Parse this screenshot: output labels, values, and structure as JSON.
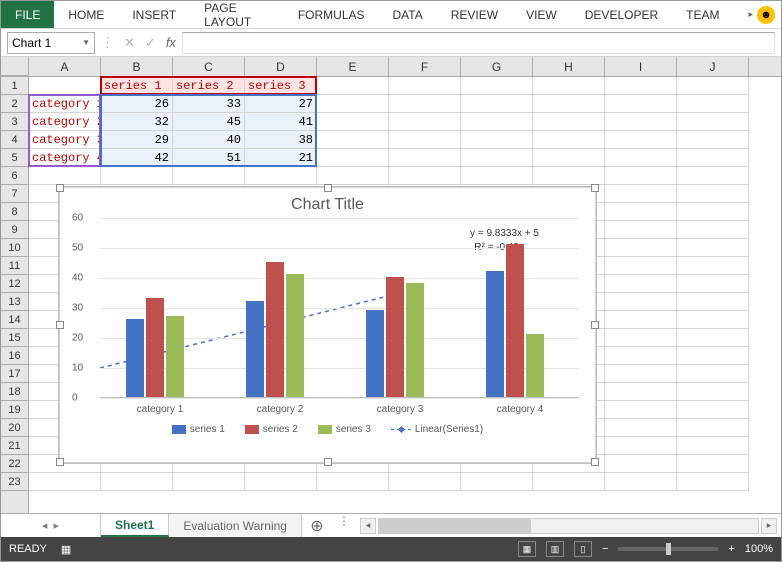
{
  "ribbon": {
    "tabs": [
      "FILE",
      "HOME",
      "INSERT",
      "PAGE LAYOUT",
      "FORMULAS",
      "DATA",
      "REVIEW",
      "VIEW",
      "DEVELOPER",
      "TEAM"
    ]
  },
  "namebox": "Chart 1",
  "fx_label": "fx",
  "columns": [
    "A",
    "B",
    "C",
    "D",
    "E",
    "F",
    "G",
    "H",
    "I",
    "J"
  ],
  "rows": [
    "1",
    "2",
    "3",
    "4",
    "5",
    "6",
    "7",
    "8",
    "9",
    "10",
    "11",
    "12",
    "13",
    "14",
    "15",
    "16",
    "17",
    "18",
    "19",
    "20",
    "21",
    "22",
    "23"
  ],
  "data": {
    "headers": [
      "series 1",
      "series 2",
      "series 3"
    ],
    "cats": [
      "category 1",
      "category 2",
      "category 3",
      "category 4"
    ],
    "vals": [
      [
        "26",
        "33",
        "27"
      ],
      [
        "32",
        "45",
        "41"
      ],
      [
        "29",
        "40",
        "38"
      ],
      [
        "42",
        "51",
        "21"
      ]
    ]
  },
  "chart_data": {
    "type": "bar",
    "title": "Chart Title",
    "categories": [
      "category 1",
      "category 2",
      "category 3",
      "category 4"
    ],
    "series": [
      {
        "name": "series 1",
        "values": [
          26,
          32,
          29,
          42
        ],
        "color": "#4472c4"
      },
      {
        "name": "series 2",
        "values": [
          33,
          45,
          40,
          51
        ],
        "color": "#c0504d"
      },
      {
        "name": "series 3",
        "values": [
          27,
          41,
          38,
          21
        ],
        "color": "#9bbb59"
      }
    ],
    "ylim": [
      0,
      60
    ],
    "yticks": [
      0,
      10,
      20,
      30,
      40,
      50,
      60
    ],
    "trendline": {
      "label": "Linear(Series1)",
      "equation": "y = 9.8333x + 5",
      "r2": "R² = -0.48"
    }
  },
  "sheets": {
    "active": "Sheet1",
    "other": "Evaluation Warning"
  },
  "status": {
    "ready": "READY",
    "zoom": "100%",
    "minus": "−",
    "plus": "+"
  }
}
